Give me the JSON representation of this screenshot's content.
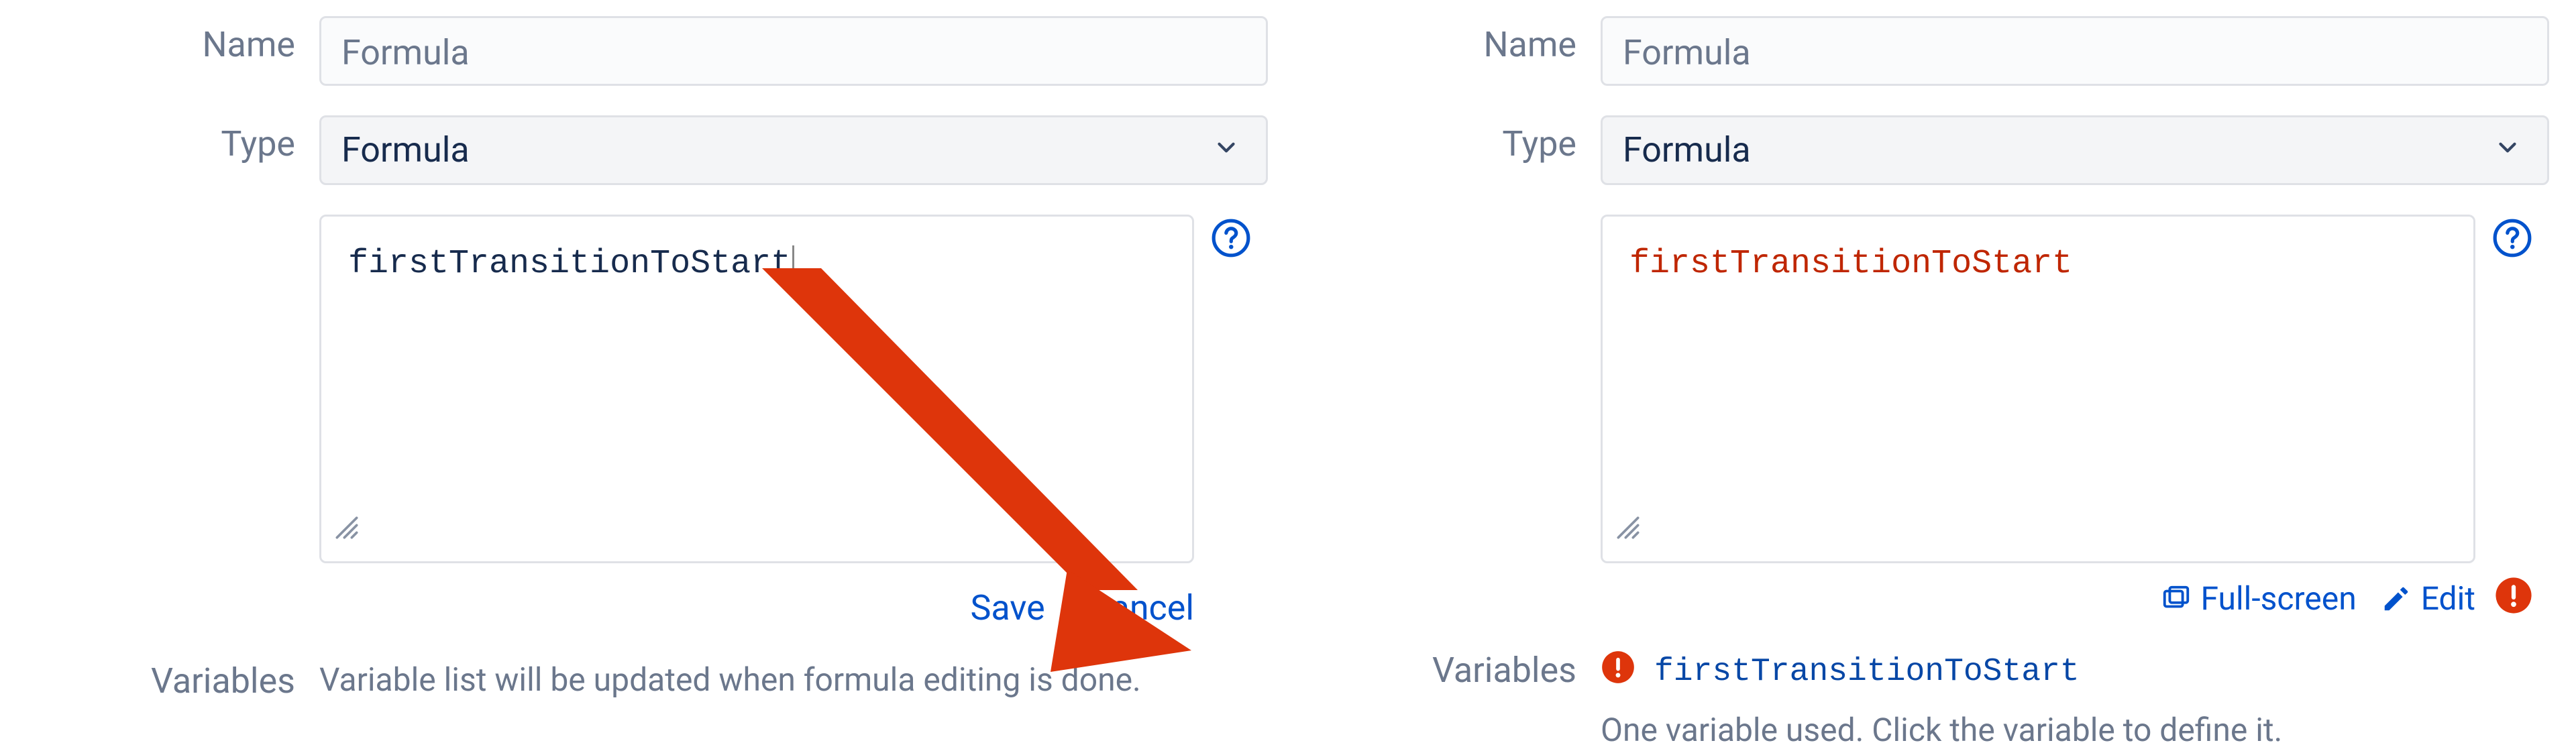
{
  "left": {
    "labels": {
      "name": "Name",
      "type": "Type",
      "variables": "Variables"
    },
    "name_value": "Formula",
    "type_value": "Formula",
    "editor_text": "firstTransitionToStart",
    "actions": {
      "save": "Save",
      "cancel": "Cancel"
    },
    "variables_note": "Variable list will be updated when formula editing is done."
  },
  "right": {
    "labels": {
      "name": "Name",
      "type": "Type",
      "variables": "Variables"
    },
    "name_value": "Formula",
    "type_value": "Formula",
    "editor_text": "firstTransitionToStart",
    "actions": {
      "fullscreen": "Full-screen",
      "edit": "Edit"
    },
    "variable_link": "firstTransitionToStart",
    "variable_note": "One variable used. Click the variable to define it."
  }
}
